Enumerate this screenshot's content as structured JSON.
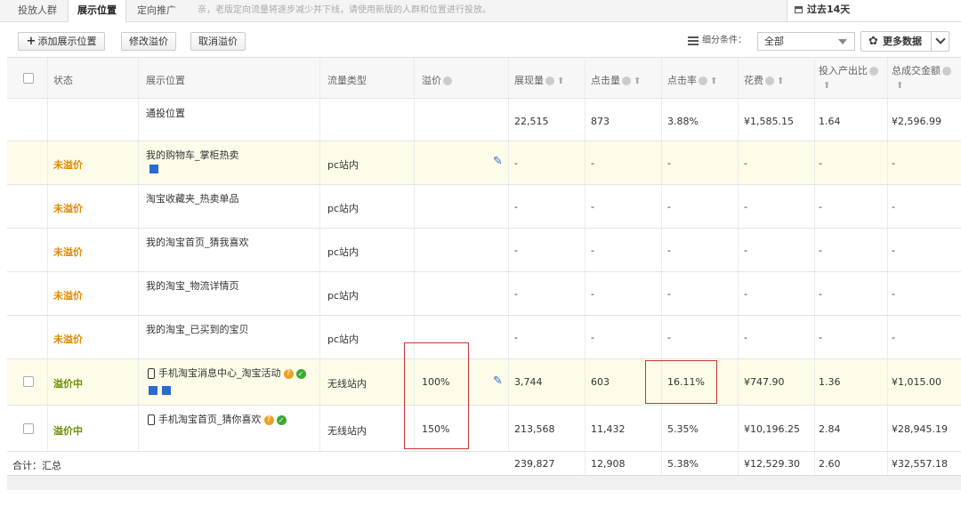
{
  "tabs": [
    {
      "label": "投放人群"
    },
    {
      "label": "展示位置"
    },
    {
      "label": "定向推广"
    }
  ],
  "notice": "亲，老版定向流量将逐步减少并下线，请使用新版的人群和位置进行投放。",
  "date_range": "过去14天",
  "toolbar": {
    "add_label": "添加展示位置",
    "edit_label": "修改溢价",
    "cancel_label": "取消溢价",
    "filter_label": "细分条件：",
    "filter_value": "全部",
    "more_label": "更多数据"
  },
  "columns": {
    "status": "状态",
    "position": "展示位置",
    "traffic": "流量类型",
    "premium": "溢价",
    "impressions": "展现量",
    "clicks": "点击量",
    "ctr": "点击率",
    "cost": "花费",
    "roi": "投入产出比",
    "gmv": "总成交金额"
  },
  "rows": [
    {
      "status": "",
      "position": "通投位置",
      "traffic": "",
      "premium": "",
      "impressions": "22,515",
      "clicks": "873",
      "ctr": "3.88%",
      "cost": "¥1,585.15",
      "roi": "1.64",
      "gmv": "¥2,596.99"
    },
    {
      "status": "未溢价",
      "position": "我的购物车_掌柜热卖",
      "traffic": "pc站内",
      "premium": "",
      "impressions": "-",
      "clicks": "-",
      "ctr": "-",
      "cost": "-",
      "roi": "-",
      "gmv": "-"
    },
    {
      "status": "未溢价",
      "position": "淘宝收藏夹_热卖单品",
      "traffic": "pc站内",
      "premium": "",
      "impressions": "-",
      "clicks": "-",
      "ctr": "-",
      "cost": "-",
      "roi": "-",
      "gmv": "-"
    },
    {
      "status": "未溢价",
      "position": "我的淘宝首页_猜我喜欢",
      "traffic": "pc站内",
      "premium": "",
      "impressions": "-",
      "clicks": "-",
      "ctr": "-",
      "cost": "-",
      "roi": "-",
      "gmv": "-"
    },
    {
      "status": "未溢价",
      "position": "我的淘宝_物流详情页",
      "traffic": "pc站内",
      "premium": "",
      "impressions": "-",
      "clicks": "-",
      "ctr": "-",
      "cost": "-",
      "roi": "-",
      "gmv": "-"
    },
    {
      "status": "未溢价",
      "position": "我的淘宝_已买到的宝贝",
      "traffic": "pc站内",
      "premium": "",
      "impressions": "-",
      "clicks": "-",
      "ctr": "-",
      "cost": "-",
      "roi": "-",
      "gmv": "-"
    },
    {
      "status": "溢价中",
      "position": "手机淘宝消息中心_淘宝活动",
      "traffic": "无线站内",
      "premium": "100%",
      "impressions": "3,744",
      "clicks": "603",
      "ctr": "16.11%",
      "cost": "¥747.90",
      "roi": "1.36",
      "gmv": "¥1,015.00"
    },
    {
      "status": "溢价中",
      "position": "手机淘宝首页_猜你喜欢",
      "traffic": "无线站内",
      "premium": "150%",
      "impressions": "213,568",
      "clicks": "11,432",
      "ctr": "5.35%",
      "cost": "¥10,196.25",
      "roi": "2.84",
      "gmv": "¥28,945.19"
    }
  ],
  "summary": {
    "label": "合计：汇总",
    "impressions": "239,827",
    "clicks": "12,908",
    "ctr": "5.38%",
    "cost": "¥12,529.30",
    "roi": "2.60",
    "gmv": "¥32,557.18"
  },
  "colors": {
    "pending": "#e08a00",
    "active": "#6a8f00",
    "highlight_row": "#fcfce8",
    "annotation_box": "#c9333a",
    "edit_icon": "#2a6bd0"
  }
}
